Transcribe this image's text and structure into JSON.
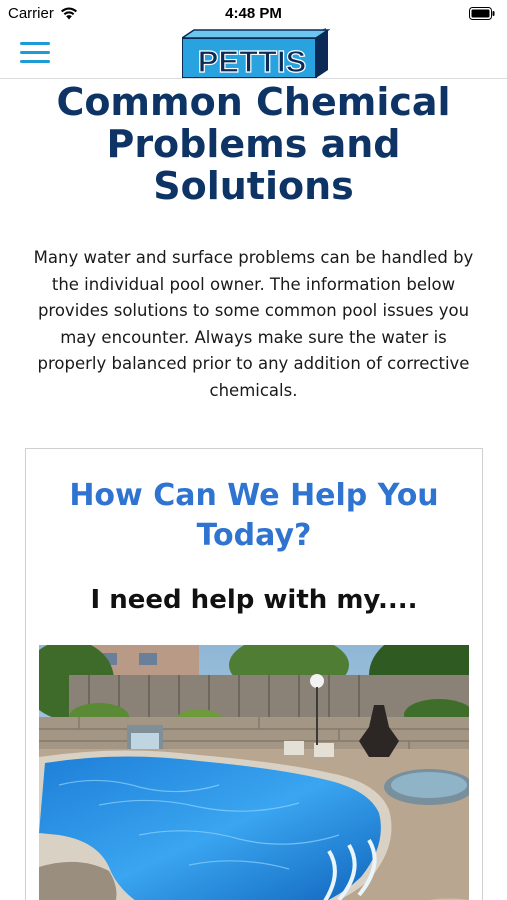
{
  "status_bar": {
    "carrier": "Carrier",
    "time": "4:48 PM"
  },
  "nav": {
    "menu_icon": "hamburger-menu-icon",
    "logo_text": "PETTIS",
    "accent_color": "#1e9bd7"
  },
  "page": {
    "title": "Common Chemical Problems and Solutions",
    "intro": "Many water and surface problems can be handled by the individual pool owner. The information below provides solutions to some common pool issues you may encounter. Always make sure the water is properly balanced prior to any addition of corrective chemicals.",
    "title_color": "#0e3466"
  },
  "help_card": {
    "heading": "How Can We Help You Today?",
    "subheading": "I need help with my....",
    "heading_color": "#2f74d0"
  }
}
